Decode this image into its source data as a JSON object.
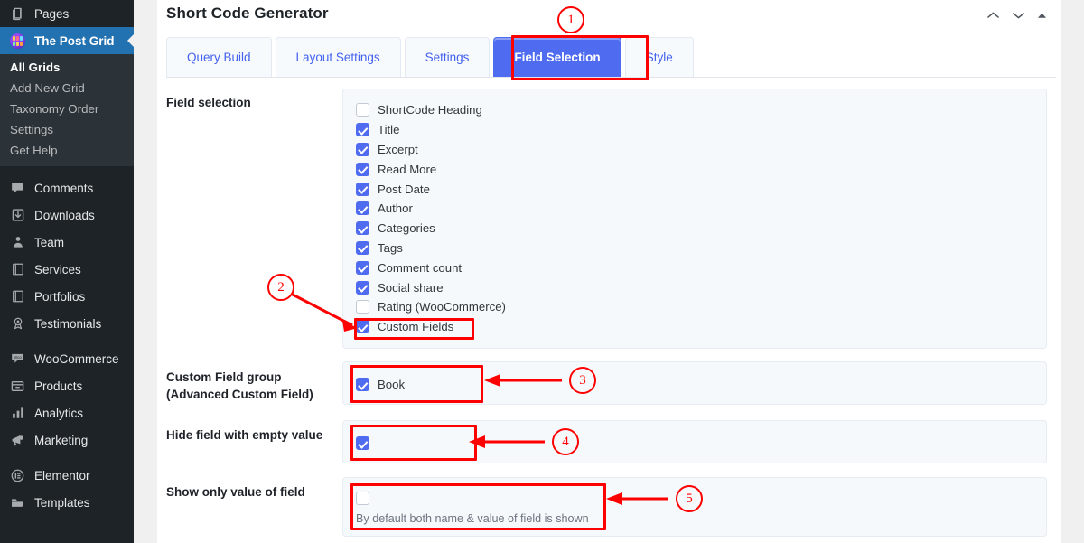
{
  "sidebar": {
    "items": [
      {
        "label": "Pages",
        "icon": "pages-icon"
      },
      {
        "label": "The Post Grid",
        "icon": "post-grid-logo-icon",
        "current": true
      }
    ],
    "submenu": [
      {
        "label": "All Grids",
        "active": true
      },
      {
        "label": "Add New Grid",
        "active": false
      },
      {
        "label": "Taxonomy Order",
        "active": false
      },
      {
        "label": "Settings",
        "active": false
      },
      {
        "label": "Get Help",
        "active": false
      }
    ],
    "group_two": [
      {
        "label": "Comments",
        "icon": "comment-bubble-icon"
      },
      {
        "label": "Downloads",
        "icon": "download-icon"
      },
      {
        "label": "Team",
        "icon": "person-icon"
      },
      {
        "label": "Services",
        "icon": "book-icon"
      },
      {
        "label": "Portfolios",
        "icon": "book-icon"
      },
      {
        "label": "Testimonials",
        "icon": "award-ribbon-icon"
      }
    ],
    "group_three": [
      {
        "label": "WooCommerce",
        "icon": "woocommerce-icon"
      },
      {
        "label": "Products",
        "icon": "product-box-icon"
      },
      {
        "label": "Analytics",
        "icon": "bar-chart-icon"
      },
      {
        "label": "Marketing",
        "icon": "megaphone-icon"
      }
    ],
    "group_four": [
      {
        "label": "Elementor",
        "icon": "elementor-icon"
      },
      {
        "label": "Templates",
        "icon": "folder-icon"
      }
    ]
  },
  "header": {
    "title": "Short Code Generator",
    "controls": [
      {
        "name": "move-up-icon"
      },
      {
        "name": "move-down-icon"
      },
      {
        "name": "collapse-icon"
      }
    ]
  },
  "tabs": [
    {
      "label": "Query Build",
      "active": false
    },
    {
      "label": "Layout Settings",
      "active": false
    },
    {
      "label": "Settings",
      "active": false
    },
    {
      "label": "Field Selection",
      "active": true
    },
    {
      "label": "Style",
      "active": false
    }
  ],
  "sections": {
    "field_selection": {
      "label": "Field selection",
      "options": [
        {
          "label": "ShortCode Heading",
          "checked": false
        },
        {
          "label": "Title",
          "checked": true
        },
        {
          "label": "Excerpt",
          "checked": true
        },
        {
          "label": "Read More",
          "checked": true
        },
        {
          "label": "Post Date",
          "checked": true
        },
        {
          "label": "Author",
          "checked": true
        },
        {
          "label": "Categories",
          "checked": true
        },
        {
          "label": "Tags",
          "checked": true
        },
        {
          "label": "Comment count",
          "checked": true
        },
        {
          "label": "Social share",
          "checked": true
        },
        {
          "label": "Rating (WooCommerce)",
          "checked": false
        },
        {
          "label": "Custom Fields",
          "checked": true
        }
      ]
    },
    "custom_field_group": {
      "label_line1": "Custom Field group",
      "label_line2": "(Advanced Custom Field)",
      "options": [
        {
          "label": "Book",
          "checked": true
        }
      ]
    },
    "hide_empty": {
      "label": "Hide field with empty value",
      "checked": true
    },
    "show_only_value": {
      "label": "Show only value of field",
      "checked": false,
      "hint": "By default both name & value of field is shown"
    }
  },
  "annotations": {
    "accent_color": "#ff0000",
    "markers": [
      {
        "number": "1"
      },
      {
        "number": "2"
      },
      {
        "number": "3"
      },
      {
        "number": "4"
      },
      {
        "number": "5"
      }
    ]
  },
  "colors": {
    "sidebar_bg": "#1d2327",
    "sidebar_current": "#2271b1",
    "tab_active": "#4f6cf0",
    "tab_text": "#4361ee",
    "panel_bg": "#f6f9fc"
  }
}
